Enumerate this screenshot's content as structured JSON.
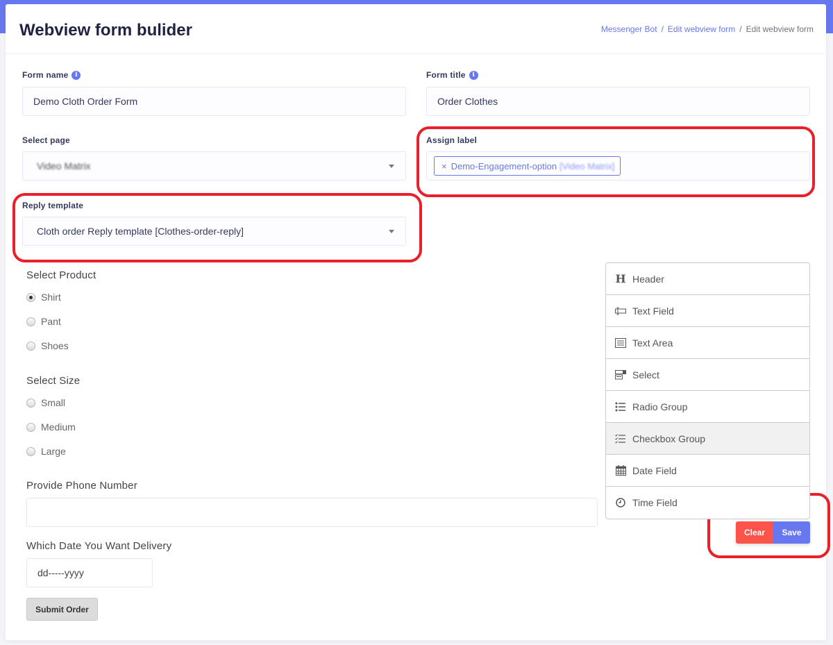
{
  "page": {
    "title": "Webview form bulider",
    "breadcrumb": [
      "Messenger Bot",
      "Edit webview form",
      "Edit webview form"
    ]
  },
  "form_settings": {
    "form_name": {
      "label": "Form name",
      "value": "Demo Cloth Order Form"
    },
    "form_title": {
      "label": "Form title",
      "value": "Order Clothes"
    },
    "select_page": {
      "label": "Select page",
      "value": "Video Matrix"
    },
    "assign_label": {
      "label": "Assign label",
      "tag_remove": "×",
      "tag_text": "Demo-Engagement-option",
      "tag_suffix": "[Video Matrix]"
    },
    "reply_template": {
      "label": "Reply template",
      "value": "Cloth order Reply template [Clothes-order-reply]"
    }
  },
  "preview": {
    "product": {
      "label": "Select Product",
      "options": [
        "Shirt",
        "Pant",
        "Shoes"
      ],
      "selected": "Shirt"
    },
    "size": {
      "label": "Select Size",
      "options": [
        "Small",
        "Medium",
        "Large"
      ]
    },
    "phone": {
      "label": "Provide Phone Number",
      "value": ""
    },
    "delivery_date": {
      "label": "Which Date You Want Delivery",
      "placeholder": "dd-----yyyy"
    },
    "submit_label": "Submit Order"
  },
  "controls": [
    {
      "label": "Header",
      "icon": "header-icon"
    },
    {
      "label": "Text Field",
      "icon": "text-field-icon"
    },
    {
      "label": "Text Area",
      "icon": "text-area-icon"
    },
    {
      "label": "Select",
      "icon": "select-icon"
    },
    {
      "label": "Radio Group",
      "icon": "radio-group-icon"
    },
    {
      "label": "Checkbox Group",
      "icon": "checkbox-group-icon"
    },
    {
      "label": "Date Field",
      "icon": "calendar-icon"
    },
    {
      "label": "Time Field",
      "icon": "clock-icon"
    }
  ],
  "actions": {
    "clear": "Clear",
    "save": "Save"
  },
  "colors": {
    "primary": "#6777ef",
    "danger": "#fc544b",
    "highlight": "#e8202a"
  }
}
